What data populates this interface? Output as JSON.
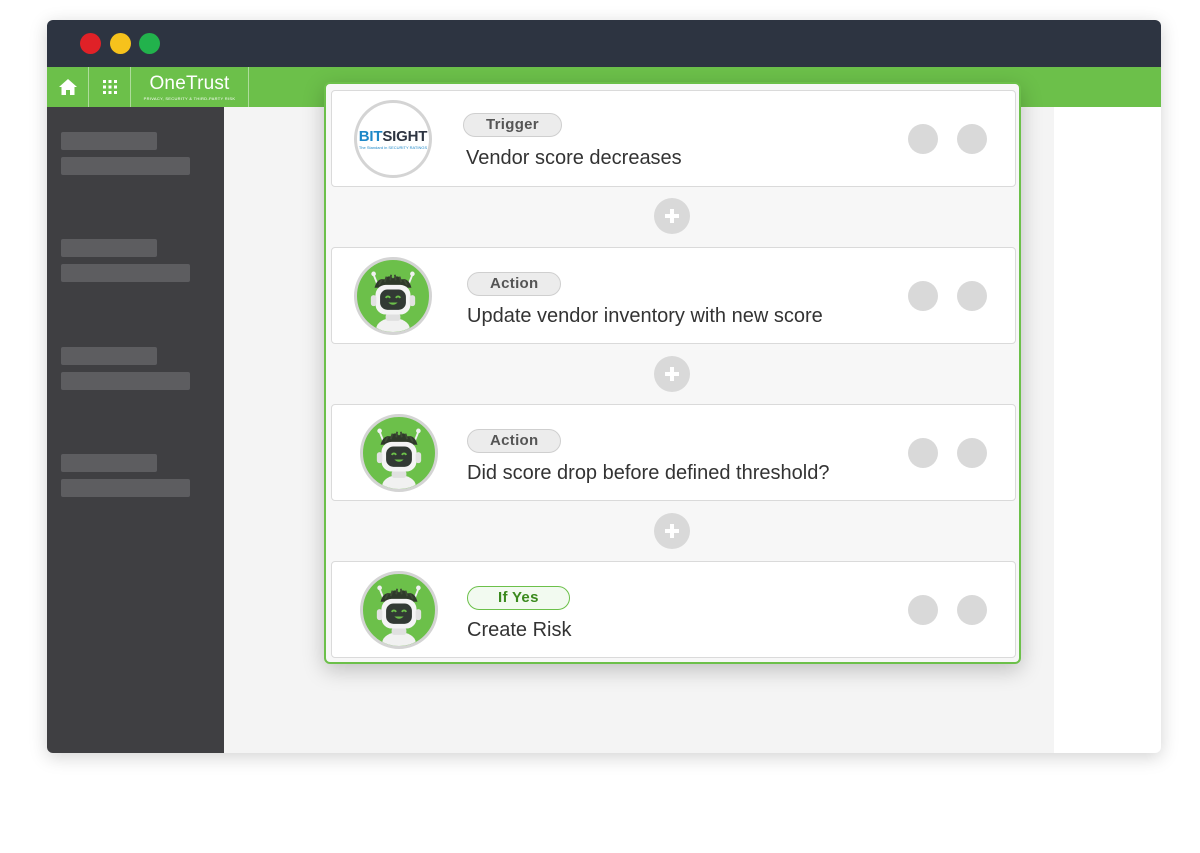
{
  "window": {
    "controls": [
      "close",
      "minimize",
      "maximize"
    ],
    "colors": {
      "close": "#e02127",
      "minimize": "#f6c21c",
      "maximize": "#22b24c",
      "titlebar": "#2d3441"
    }
  },
  "app": {
    "brand_name": "OneTrust",
    "brand_tagline": "PRIVACY, SECURITY & THIRD-PARTY RISK",
    "accent_color": "#6cc04a",
    "home_icon": "home-icon",
    "apps_icon": "grid-icon"
  },
  "workflow": {
    "steps": [
      {
        "badge": "Trigger",
        "text": "Vendor score decreases",
        "avatar": "bitsight-logo"
      },
      {
        "badge": "Action",
        "text": "Update vendor inventory with new score",
        "avatar": "robot-icon"
      },
      {
        "badge": "Action",
        "text": "Did score drop before defined threshold?",
        "avatar": "robot-icon"
      },
      {
        "badge": "If Yes",
        "text": "Create Risk",
        "avatar": "robot-icon"
      }
    ],
    "bitsight": {
      "bit": "BIT",
      "sight": "SIGHT",
      "tagline": "The Standard in SECURITY RATINGS"
    },
    "add_step_icon": "plus-icon"
  }
}
